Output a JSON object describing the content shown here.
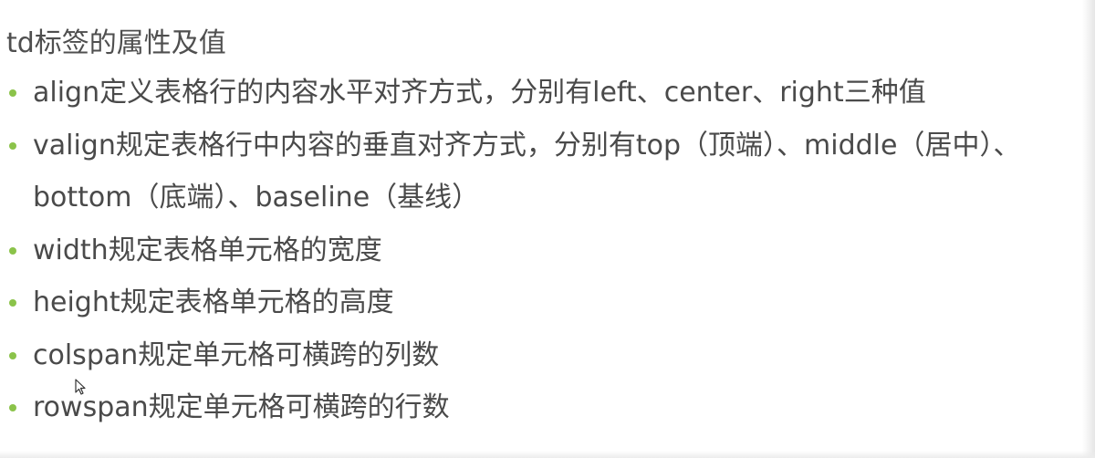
{
  "heading": "td标签的属性及值",
  "bullets": [
    "align定义表格行的内容水平对齐方式，分别有left、center、right三种值",
    "valign规定表格行中内容的垂直对齐方式，分别有top（顶端）、middle（居中）、bottom（底端）、baseline（基线）",
    "width规定表格单元格的宽度",
    "height规定表格单元格的高度",
    "colspan规定单元格可横跨的列数",
    "rowspan规定单元格可横跨的行数"
  ],
  "colors": {
    "bullet": "#8bc34a",
    "text": "#4a4a4a",
    "background": "#ffffff"
  },
  "icons": {
    "cursor": "mouse-pointer-icon",
    "bullet": "bullet-dot-icon"
  }
}
